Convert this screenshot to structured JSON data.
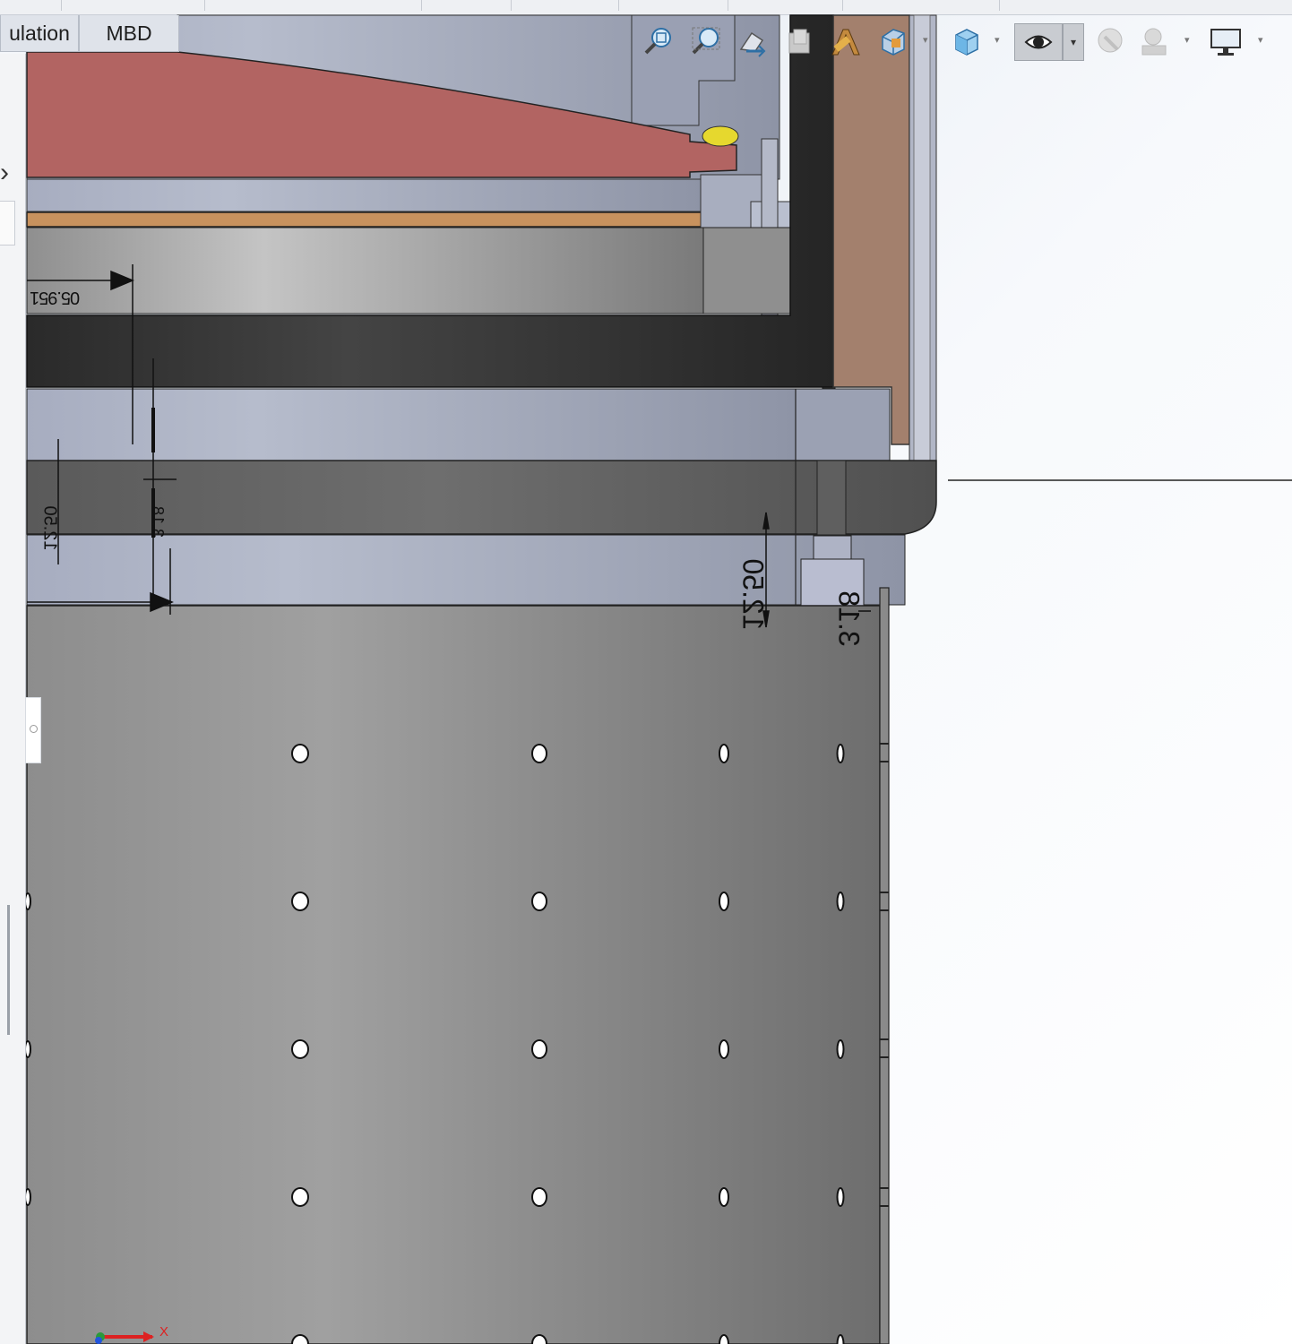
{
  "tabs": [
    {
      "label": "ulation"
    },
    {
      "label": "MBD"
    }
  ],
  "toolbar": {
    "icons": [
      "zoom-to-fit-icon",
      "zoom-to-area-icon",
      "previous-view-icon",
      "section-view-icon",
      "dynamic-annotation-icon",
      "view-orientation-icon",
      "display-style-icon",
      "hide-show-items-icon",
      "edit-appearance-icon",
      "apply-scene-icon",
      "view-settings-icon"
    ]
  },
  "dimensions": {
    "d1": "05.951",
    "d2": "12.50",
    "d3": "3.18",
    "d4": "12.50",
    "d5": "3.18"
  },
  "triad": {
    "x_label": "X"
  },
  "colors": {
    "red_part": "#b26462",
    "copper_band": "#c8925e",
    "brown_part": "#a3806d",
    "dark_steel": "#2e2e2e",
    "yellow_seal": "#e6d82e",
    "plate_gray": "#8e8e8e"
  }
}
